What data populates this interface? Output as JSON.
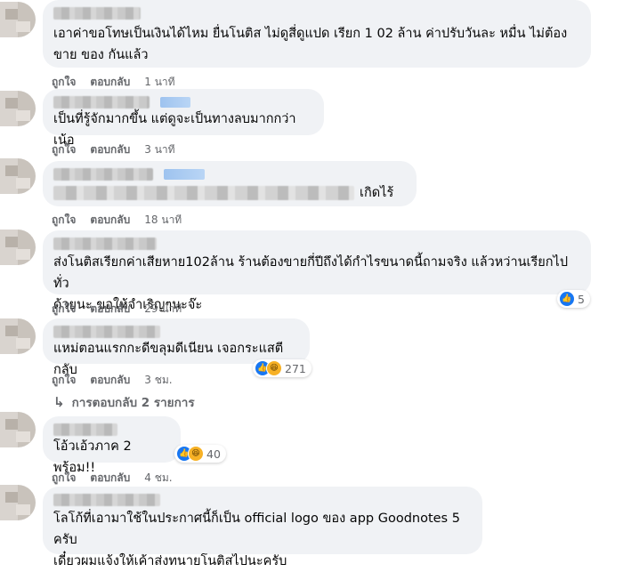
{
  "labels": {
    "like": "ถูกใจ",
    "reply": "ตอบกลับ"
  },
  "reaction_icons": {
    "like": "like-icon",
    "haha": "haha-icon"
  },
  "colors": {
    "bubble": "#f0f2f5",
    "link_blue": "#1877f2",
    "meta_gray": "#65676b"
  },
  "comments": [
    {
      "text": "เอาค่าขอโทษเป็นเงินได้ไหม ยื่นโนติส ไม่ดูสี่ดูแปด เรียก 1 02 ล้าน ค่าปรับวันละ หมื่น ไม่ต้อง\nขาย ของ กันแล้ว",
      "time": "1 นาที"
    },
    {
      "text": "เป็นที่รู้จักมากขึ้น แต่ดูจะเป็นทางลบมากกว่าเน้อ",
      "time": "3 นาที"
    },
    {
      "text": "เกิดไร้",
      "time": "18 นาที"
    },
    {
      "text": "ส่งโนติสเรียกค่าเสียหาย102ล้าน ร้านต้องขายกี่ปีถึงได้กำไรขนาดนี้ถามจริง แล้วหว่านเรียกไปทั่ว\nด้วยนะ ขอให้จำเริญๆนะจ๊ะ",
      "time": "29 นาที",
      "reactions": "5"
    },
    {
      "text": "แหม่ตอนแรกกะดีขลุมดีเนียน เจอกระแสตีกลับ",
      "time": "3 ชม.",
      "reactions": "271"
    },
    {
      "text": "โอ้วเอ้วภาค 2 พร้อม!!",
      "time": "4 ชม.",
      "reactions": "40"
    },
    {
      "text": "โลโก้ที่เอามาใช้ในประกาศนี้ก็เป็น official logo ของ app Goodnotes 5 ครับ\nเดี๋ยวผมแจ้งให้เค้าส่งทนายโนติสไปนะครับ"
    }
  ],
  "replies_link": "การตอบกลับ 2 รายการ"
}
